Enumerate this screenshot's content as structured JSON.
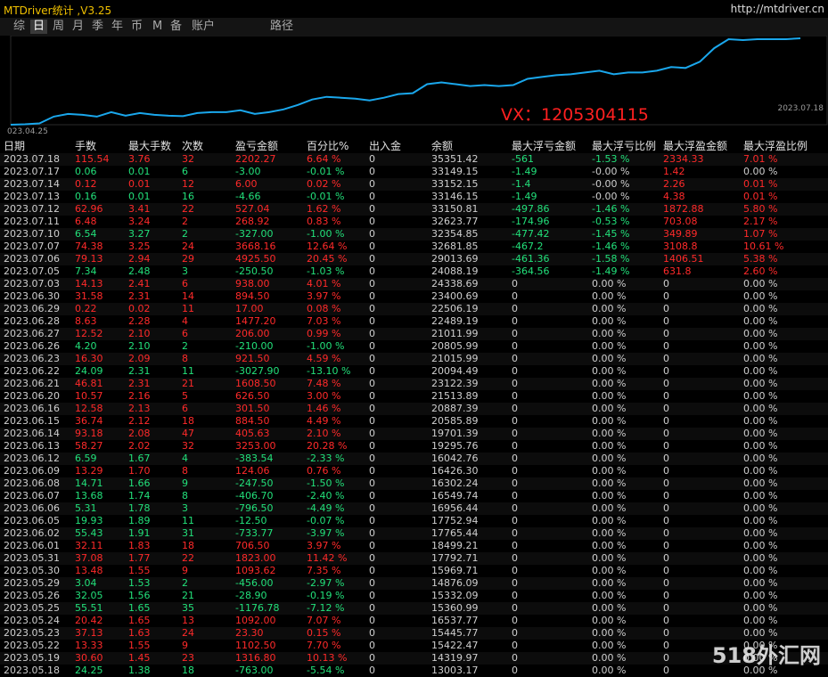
{
  "app": {
    "title": "MTDriver统计 ,V3.25",
    "url": "http://mtdriver.cn"
  },
  "tabs": [
    "综",
    "日",
    "周",
    "月",
    "季",
    "年",
    "币",
    "M",
    "备",
    "账户",
    "路径"
  ],
  "active_tab": 1,
  "chart": {
    "start_label": "023.04.25",
    "end_label": "2023.07.18",
    "annotation": "VX：1205304115",
    "line_color": "#1aa7ec",
    "points": [
      0,
      0.5,
      1.5,
      9,
      12,
      11,
      9,
      14,
      10,
      13,
      11,
      10,
      9.5,
      13,
      14,
      14,
      16,
      12,
      14,
      17,
      22,
      28,
      31,
      30,
      29,
      27,
      30,
      34,
      35,
      45,
      47,
      45,
      43,
      44,
      43,
      44,
      51,
      53,
      55,
      56,
      58,
      60,
      56,
      58,
      58,
      60,
      64,
      63,
      70,
      85,
      95,
      94,
      95,
      95,
      95,
      96
    ]
  },
  "columns": [
    "日期",
    "手数",
    "最大手数",
    "次数",
    "盈亏金额",
    "百分比%",
    "出入金",
    "余额",
    "最大浮亏金额",
    "最大浮亏比例",
    "最大浮盈金额",
    "最大浮盈比例"
  ],
  "colors": {
    "positive": "#22e07a",
    "negative": "#ff2a2a",
    "accent": "#f0c000"
  },
  "rows": [
    [
      "2023.07.18",
      "115.54",
      "3.76",
      "32",
      "2202.27",
      "6.64 %",
      "0",
      "35351.42",
      "-561",
      "-1.53 %",
      "2334.33",
      "7.01 %"
    ],
    [
      "2023.07.17",
      "0.06",
      "0.01",
      "6",
      "-3.00",
      "-0.01 %",
      "0",
      "33149.15",
      "-1.49",
      "-0.00 %",
      "1.42",
      "0.00 %"
    ],
    [
      "2023.07.14",
      "0.12",
      "0.01",
      "12",
      "6.00",
      "0.02 %",
      "0",
      "33152.15",
      "-1.4",
      "-0.00 %",
      "2.26",
      "0.01 %"
    ],
    [
      "2023.07.13",
      "0.16",
      "0.01",
      "16",
      "-4.66",
      "-0.01 %",
      "0",
      "33146.15",
      "-1.49",
      "-0.00 %",
      "4.38",
      "0.01 %"
    ],
    [
      "2023.07.12",
      "62.96",
      "3.41",
      "22",
      "527.04",
      "1.62 %",
      "0",
      "33150.81",
      "-497.86",
      "-1.46 %",
      "1872.88",
      "5.80 %"
    ],
    [
      "2023.07.11",
      "6.48",
      "3.24",
      "2",
      "268.92",
      "0.83 %",
      "0",
      "32623.77",
      "-174.96",
      "-0.53 %",
      "703.08",
      "2.17 %"
    ],
    [
      "2023.07.10",
      "6.54",
      "3.27",
      "2",
      "-327.00",
      "-1.00 %",
      "0",
      "32354.85",
      "-477.42",
      "-1.45 %",
      "349.89",
      "1.07 %"
    ],
    [
      "2023.07.07",
      "74.38",
      "3.25",
      "24",
      "3668.16",
      "12.64 %",
      "0",
      "32681.85",
      "-467.2",
      "-1.46 %",
      "3108.8",
      "10.61 %"
    ],
    [
      "2023.07.06",
      "79.13",
      "2.94",
      "29",
      "4925.50",
      "20.45 %",
      "0",
      "29013.69",
      "-461.36",
      "-1.58 %",
      "1406.51",
      "5.38 %"
    ],
    [
      "2023.07.05",
      "7.34",
      "2.48",
      "3",
      "-250.50",
      "-1.03 %",
      "0",
      "24088.19",
      "-364.56",
      "-1.49 %",
      "631.8",
      "2.60 %"
    ],
    [
      "2023.07.03",
      "14.13",
      "2.41",
      "6",
      "938.00",
      "4.01 %",
      "0",
      "24338.69",
      "0",
      "0.00 %",
      "0",
      "0.00 %"
    ],
    [
      "2023.06.30",
      "31.58",
      "2.31",
      "14",
      "894.50",
      "3.97 %",
      "0",
      "23400.69",
      "0",
      "0.00 %",
      "0",
      "0.00 %"
    ],
    [
      "2023.06.29",
      "0.22",
      "0.02",
      "11",
      "17.00",
      "0.08 %",
      "0",
      "22506.19",
      "0",
      "0.00 %",
      "0",
      "0.00 %"
    ],
    [
      "2023.06.28",
      "8.63",
      "2.28",
      "4",
      "1477.20",
      "7.03 %",
      "0",
      "22489.19",
      "0",
      "0.00 %",
      "0",
      "0.00 %"
    ],
    [
      "2023.06.27",
      "12.52",
      "2.10",
      "6",
      "206.00",
      "0.99 %",
      "0",
      "21011.99",
      "0",
      "0.00 %",
      "0",
      "0.00 %"
    ],
    [
      "2023.06.26",
      "4.20",
      "2.10",
      "2",
      "-210.00",
      "-1.00 %",
      "0",
      "20805.99",
      "0",
      "0.00 %",
      "0",
      "0.00 %"
    ],
    [
      "2023.06.23",
      "16.30",
      "2.09",
      "8",
      "921.50",
      "4.59 %",
      "0",
      "21015.99",
      "0",
      "0.00 %",
      "0",
      "0.00 %"
    ],
    [
      "2023.06.22",
      "24.09",
      "2.31",
      "11",
      "-3027.90",
      "-13.10 %",
      "0",
      "20094.49",
      "0",
      "0.00 %",
      "0",
      "0.00 %"
    ],
    [
      "2023.06.21",
      "46.81",
      "2.31",
      "21",
      "1608.50",
      "7.48 %",
      "0",
      "23122.39",
      "0",
      "0.00 %",
      "0",
      "0.00 %"
    ],
    [
      "2023.06.20",
      "10.57",
      "2.16",
      "5",
      "626.50",
      "3.00 %",
      "0",
      "21513.89",
      "0",
      "0.00 %",
      "0",
      "0.00 %"
    ],
    [
      "2023.06.16",
      "12.58",
      "2.13",
      "6",
      "301.50",
      "1.46 %",
      "0",
      "20887.39",
      "0",
      "0.00 %",
      "0",
      "0.00 %"
    ],
    [
      "2023.06.15",
      "36.74",
      "2.12",
      "18",
      "884.50",
      "4.49 %",
      "0",
      "20585.89",
      "0",
      "0.00 %",
      "0",
      "0.00 %"
    ],
    [
      "2023.06.14",
      "93.18",
      "2.08",
      "47",
      "405.63",
      "2.10 %",
      "0",
      "19701.39",
      "0",
      "0.00 %",
      "0",
      "0.00 %"
    ],
    [
      "2023.06.13",
      "58.27",
      "2.02",
      "32",
      "3253.00",
      "20.28 %",
      "0",
      "19295.76",
      "0",
      "0.00 %",
      "0",
      "0.00 %"
    ],
    [
      "2023.06.12",
      "6.59",
      "1.67",
      "4",
      "-383.54",
      "-2.33 %",
      "0",
      "16042.76",
      "0",
      "0.00 %",
      "0",
      "0.00 %"
    ],
    [
      "2023.06.09",
      "13.29",
      "1.70",
      "8",
      "124.06",
      "0.76 %",
      "0",
      "16426.30",
      "0",
      "0.00 %",
      "0",
      "0.00 %"
    ],
    [
      "2023.06.08",
      "14.71",
      "1.66",
      "9",
      "-247.50",
      "-1.50 %",
      "0",
      "16302.24",
      "0",
      "0.00 %",
      "0",
      "0.00 %"
    ],
    [
      "2023.06.07",
      "13.68",
      "1.74",
      "8",
      "-406.70",
      "-2.40 %",
      "0",
      "16549.74",
      "0",
      "0.00 %",
      "0",
      "0.00 %"
    ],
    [
      "2023.06.06",
      "5.31",
      "1.78",
      "3",
      "-796.50",
      "-4.49 %",
      "0",
      "16956.44",
      "0",
      "0.00 %",
      "0",
      "0.00 %"
    ],
    [
      "2023.06.05",
      "19.93",
      "1.89",
      "11",
      "-12.50",
      "-0.07 %",
      "0",
      "17752.94",
      "0",
      "0.00 %",
      "0",
      "0.00 %"
    ],
    [
      "2023.06.02",
      "55.43",
      "1.91",
      "31",
      "-733.77",
      "-3.97 %",
      "0",
      "17765.44",
      "0",
      "0.00 %",
      "0",
      "0.00 %"
    ],
    [
      "2023.06.01",
      "32.11",
      "1.83",
      "18",
      "706.50",
      "3.97 %",
      "0",
      "18499.21",
      "0",
      "0.00 %",
      "0",
      "0.00 %"
    ],
    [
      "2023.05.31",
      "37.08",
      "1.77",
      "22",
      "1823.00",
      "11.42 %",
      "0",
      "17792.71",
      "0",
      "0.00 %",
      "0",
      "0.00 %"
    ],
    [
      "2023.05.30",
      "13.48",
      "1.55",
      "9",
      "1093.62",
      "7.35 %",
      "0",
      "15969.71",
      "0",
      "0.00 %",
      "0",
      "0.00 %"
    ],
    [
      "2023.05.29",
      "3.04",
      "1.53",
      "2",
      "-456.00",
      "-2.97 %",
      "0",
      "14876.09",
      "0",
      "0.00 %",
      "0",
      "0.00 %"
    ],
    [
      "2023.05.26",
      "32.05",
      "1.56",
      "21",
      "-28.90",
      "-0.19 %",
      "0",
      "15332.09",
      "0",
      "0.00 %",
      "0",
      "0.00 %"
    ],
    [
      "2023.05.25",
      "55.51",
      "1.65",
      "35",
      "-1176.78",
      "-7.12 %",
      "0",
      "15360.99",
      "0",
      "0.00 %",
      "0",
      "0.00 %"
    ],
    [
      "2023.05.24",
      "20.42",
      "1.65",
      "13",
      "1092.00",
      "7.07 %",
      "0",
      "16537.77",
      "0",
      "0.00 %",
      "0",
      "0.00 %"
    ],
    [
      "2023.05.23",
      "37.13",
      "1.63",
      "24",
      "23.30",
      "0.15 %",
      "0",
      "15445.77",
      "0",
      "0.00 %",
      "0",
      "0.00 %"
    ],
    [
      "2023.05.22",
      "13.33",
      "1.55",
      "9",
      "1102.50",
      "7.70 %",
      "0",
      "15422.47",
      "0",
      "0.00 %",
      "0",
      "0.00 %"
    ],
    [
      "2023.05.19",
      "30.60",
      "1.45",
      "23",
      "1316.80",
      "10.13 %",
      "0",
      "14319.97",
      "0",
      "0.00 %",
      "0",
      "0.00 %"
    ],
    [
      "2023.05.18",
      "24.25",
      "1.38",
      "18",
      "-763.00",
      "-5.54 %",
      "0",
      "13003.17",
      "0",
      "0.00 %",
      "0",
      "0.00 %"
    ]
  ],
  "watermark": "518外汇网"
}
